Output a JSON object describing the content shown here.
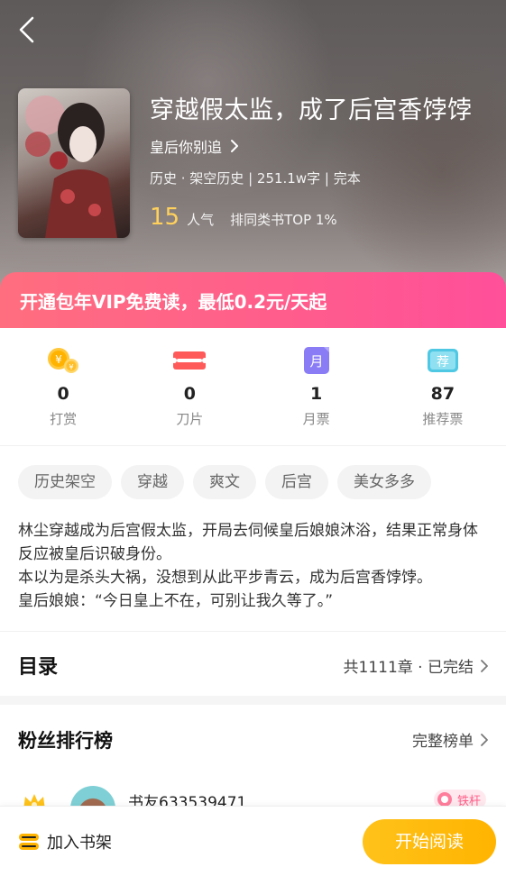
{
  "header": {
    "title": "穿越假太监，成了后宫香饽饽",
    "author": "皇后你别追",
    "meta": "历史 · 架空历史 | 251.1w字 | 完本",
    "popularity_value": "15",
    "popularity_label": "人气",
    "rank_text": "排同类书TOP 1%"
  },
  "vip_banner": {
    "text": "开通包年VIP免费读，最低0.2元/天起"
  },
  "stats": [
    {
      "value": "0",
      "label": "打赏",
      "icon": "coin-icon"
    },
    {
      "value": "0",
      "label": "刀片",
      "icon": "blade-icon"
    },
    {
      "value": "1",
      "label": "月票",
      "icon": "monthly-ticket-icon",
      "glyph": "月"
    },
    {
      "value": "87",
      "label": "推荐票",
      "icon": "recommend-ticket-icon",
      "glyph": "荐"
    }
  ],
  "tags": [
    "历史架空",
    "穿越",
    "爽文",
    "后宫",
    "美女多多"
  ],
  "synopsis": [
    "林尘穿越成为后宫假太监，开局去伺候皇后娘娘沐浴，结果正常身体反应被皇后识破身份。",
    "本以为是杀头大祸，没想到从此平步青云，成为后宫香饽饽。",
    "皇后娘娘：“今日皇上不在，可别让我久等了。”"
  ],
  "toc": {
    "title": "目录",
    "info": "共1111章 · 已完结"
  },
  "fans": {
    "title": "粉丝排行榜",
    "more": "完整榜单",
    "top": {
      "name": "书友633539471",
      "badge": "铁杆"
    }
  },
  "bottom": {
    "shelf_label": "加入书架",
    "read_label": "开始阅读"
  },
  "colors": {
    "accent": "#ffb400",
    "vip": "#ff5c8d",
    "popularity": "#ffd15c"
  }
}
